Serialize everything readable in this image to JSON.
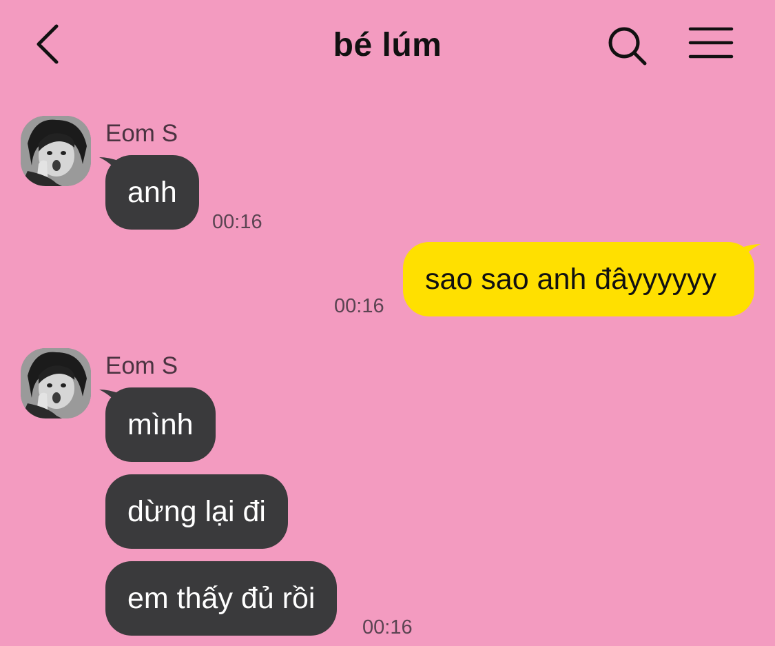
{
  "header": {
    "title": "bé lúm",
    "back_icon": "chevron-left-icon",
    "search_icon": "search-icon",
    "menu_icon": "hamburger-menu-icon"
  },
  "colors": {
    "background": "#f39bc0",
    "incoming_bubble": "#3a3a3c",
    "outgoing_bubble": "#ffe000"
  },
  "messages": [
    {
      "direction": "incoming",
      "sender": "Eom S",
      "bubbles": [
        "anh"
      ],
      "time": "00:16"
    },
    {
      "direction": "outgoing",
      "bubbles": [
        "sao sao anh đâyyyyyy"
      ],
      "time": "00:16"
    },
    {
      "direction": "incoming",
      "sender": "Eom S",
      "bubbles": [
        "mình",
        "dừng lại đi",
        "em thấy đủ rồi"
      ],
      "time": "00:16"
    }
  ]
}
